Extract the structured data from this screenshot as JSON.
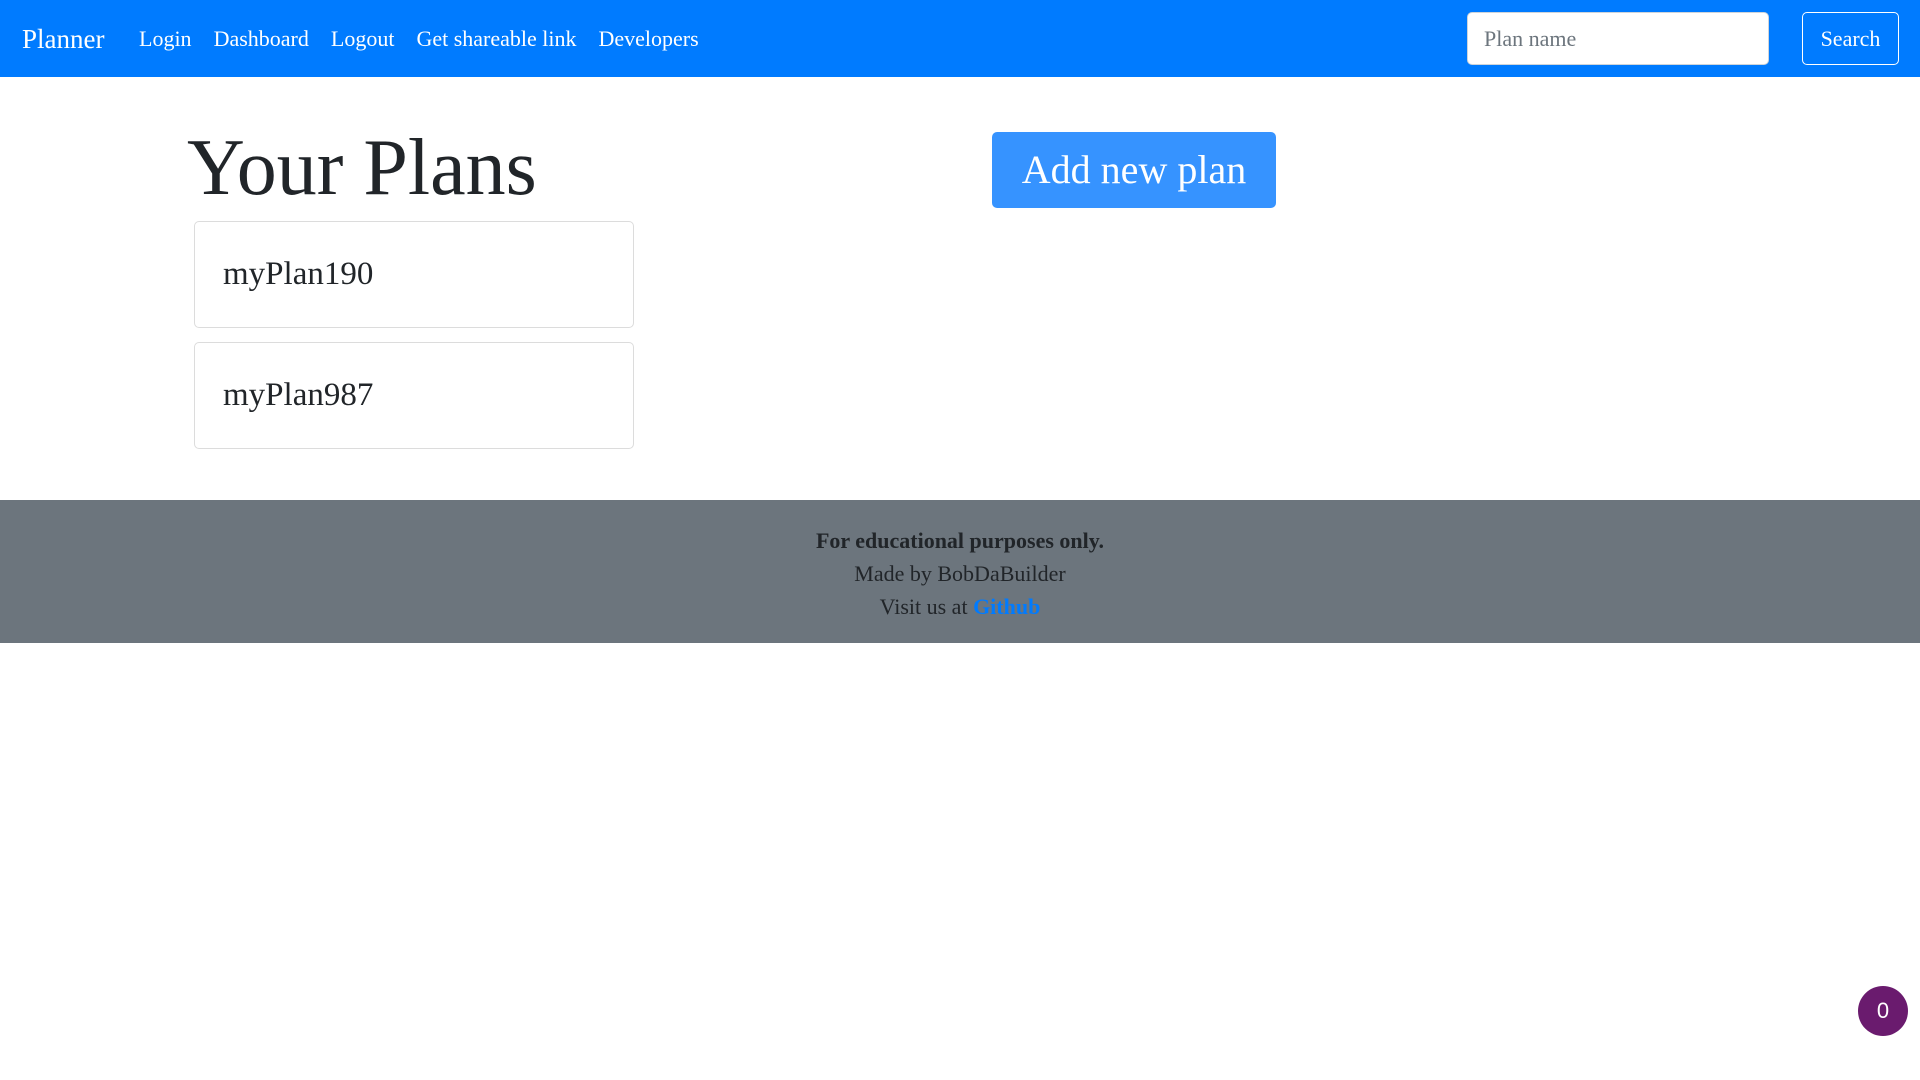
{
  "navbar": {
    "brand": "Planner",
    "links": [
      "Login",
      "Dashboard",
      "Logout",
      "Get shareable link",
      "Developers"
    ],
    "search": {
      "placeholder": "Plan name",
      "value": "",
      "button_label": "Search"
    },
    "color": "#007bff"
  },
  "main": {
    "title": "Your Plans",
    "add_button_label": "Add new plan",
    "plans": [
      {
        "name": "myPlan190"
      },
      {
        "name": "myPlan987"
      }
    ]
  },
  "footer": {
    "line1": "For educational purposes only.",
    "line2": "Made by BobDaBuilder",
    "line3_prefix": "Visit us at ",
    "line3_link": "Github",
    "color": "#6c757d"
  },
  "badge": {
    "count": "0"
  }
}
